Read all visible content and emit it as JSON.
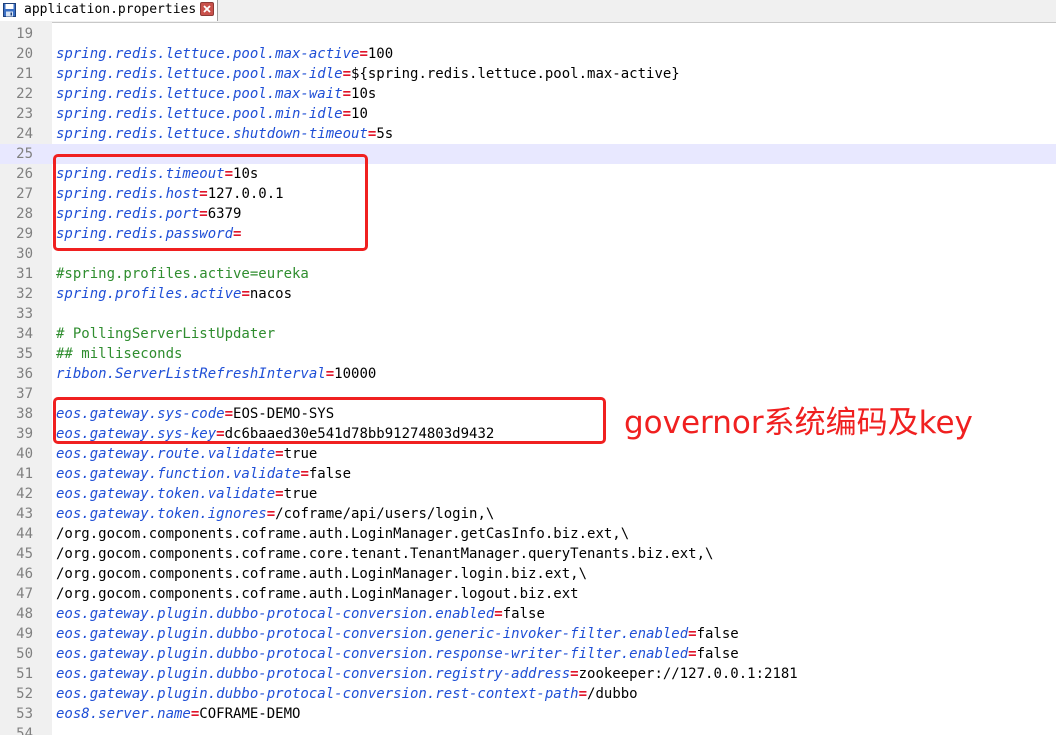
{
  "tab": {
    "title": "application.properties",
    "icon": "save-file-icon",
    "close_icon": "close-icon"
  },
  "colors": {
    "key": "#1f4fd6",
    "equals": "#e0142a",
    "comment": "#2f8d2f",
    "annotation": "#f02020",
    "current_line": "#e8e8ff"
  },
  "lines": [
    {
      "no": "19",
      "type": "blank"
    },
    {
      "no": "20",
      "type": "kv",
      "key": "spring.redis.lettuce.pool.max-active",
      "value": "100"
    },
    {
      "no": "21",
      "type": "kv",
      "key": "spring.redis.lettuce.pool.max-idle",
      "value": "${spring.redis.lettuce.pool.max-active}"
    },
    {
      "no": "22",
      "type": "kv",
      "key": "spring.redis.lettuce.pool.max-wait",
      "value": "10s"
    },
    {
      "no": "23",
      "type": "kv",
      "key": "spring.redis.lettuce.pool.min-idle",
      "value": "10"
    },
    {
      "no": "24",
      "type": "kv",
      "key": "spring.redis.lettuce.shutdown-timeout",
      "value": "5s"
    },
    {
      "no": "25",
      "type": "blank",
      "current": true
    },
    {
      "no": "26",
      "type": "kv",
      "key": "spring.redis.timeout",
      "value": "10s"
    },
    {
      "no": "27",
      "type": "kv",
      "key": "spring.redis.host",
      "value": "127.0.0.1"
    },
    {
      "no": "28",
      "type": "kv",
      "key": "spring.redis.port",
      "value": "6379"
    },
    {
      "no": "29",
      "type": "kv",
      "key": "spring.redis.password",
      "value": ""
    },
    {
      "no": "30",
      "type": "blank"
    },
    {
      "no": "31",
      "type": "comment",
      "text": "#spring.profiles.active=eureka"
    },
    {
      "no": "32",
      "type": "kv",
      "key": "spring.profiles.active",
      "value": "nacos"
    },
    {
      "no": "33",
      "type": "blank"
    },
    {
      "no": "34",
      "type": "comment",
      "text": "# PollingServerListUpdater"
    },
    {
      "no": "35",
      "type": "comment",
      "text": "## milliseconds"
    },
    {
      "no": "36",
      "type": "kv",
      "key": "ribbon.ServerListRefreshInterval",
      "value": "10000"
    },
    {
      "no": "37",
      "type": "blank"
    },
    {
      "no": "38",
      "type": "kv",
      "key": "eos.gateway.sys-code",
      "value": "EOS-DEMO-SYS"
    },
    {
      "no": "39",
      "type": "kv",
      "key": "eos.gateway.sys-key",
      "value": "dc6baaed30e541d78bb91274803d9432"
    },
    {
      "no": "40",
      "type": "kv",
      "key": "eos.gateway.route.validate",
      "value": "true"
    },
    {
      "no": "41",
      "type": "kv",
      "key": "eos.gateway.function.validate",
      "value": "false"
    },
    {
      "no": "42",
      "type": "kv",
      "key": "eos.gateway.token.validate",
      "value": "true"
    },
    {
      "no": "43",
      "type": "kv",
      "key": "eos.gateway.token.ignores",
      "value": "/coframe/api/users/login,\\"
    },
    {
      "no": "44",
      "type": "plain",
      "text": "/org.gocom.components.coframe.auth.LoginManager.getCasInfo.biz.ext,\\"
    },
    {
      "no": "45",
      "type": "plain",
      "text": "/org.gocom.components.coframe.core.tenant.TenantManager.queryTenants.biz.ext,\\"
    },
    {
      "no": "46",
      "type": "plain",
      "text": "/org.gocom.components.coframe.auth.LoginManager.login.biz.ext,\\"
    },
    {
      "no": "47",
      "type": "plain",
      "text": "/org.gocom.components.coframe.auth.LoginManager.logout.biz.ext"
    },
    {
      "no": "48",
      "type": "kv",
      "key": "eos.gateway.plugin.dubbo-protocal-conversion.enabled",
      "value": "false"
    },
    {
      "no": "49",
      "type": "kv",
      "key": "eos.gateway.plugin.dubbo-protocal-conversion.generic-invoker-filter.enabled",
      "value": "false"
    },
    {
      "no": "50",
      "type": "kv",
      "key": "eos.gateway.plugin.dubbo-protocal-conversion.response-writer-filter.enabled",
      "value": "false"
    },
    {
      "no": "51",
      "type": "kv",
      "key": "eos.gateway.plugin.dubbo-protocal-conversion.registry-address",
      "value": "zookeeper://127.0.0.1:2181"
    },
    {
      "no": "52",
      "type": "kv",
      "key": "eos.gateway.plugin.dubbo-protocal-conversion.rest-context-path",
      "value": "/dubbo"
    },
    {
      "no": "53",
      "type": "kv",
      "key": "eos8.server.name",
      "value": "COFRAME-DEMO"
    },
    {
      "no": "54",
      "type": "blank"
    }
  ],
  "annotation": {
    "text": "governor系统编码及key"
  }
}
